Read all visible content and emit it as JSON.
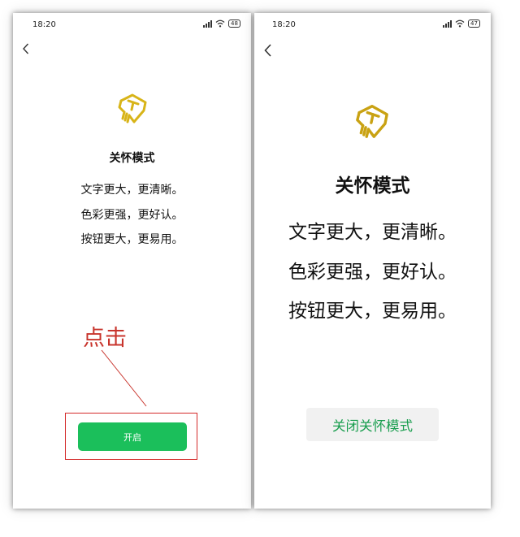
{
  "left_screen": {
    "status_time": "18:20",
    "battery": "48",
    "title": "关怀模式",
    "lines": [
      "文字更大，更清晰。",
      "色彩更强，更好认。",
      "按钮更大，更易用。"
    ],
    "button_label": "开启",
    "annotation": "点击"
  },
  "right_screen": {
    "status_time": "18:20",
    "battery": "47",
    "title": "关怀模式",
    "lines": [
      "文字更大，更清晰。",
      "色彩更强，更好认。",
      "按钮更大，更易用。"
    ],
    "button_label": "关闭关怀模式"
  },
  "colors": {
    "logo_gold": "#d8b418",
    "open_button": "#1bbf5b",
    "close_text": "#1a9e4f",
    "annotation_red": "#c8342c"
  },
  "icons": [
    "back-arrow-icon",
    "signal-icon",
    "wifi-icon",
    "battery-icon",
    "care-mode-logo-icon"
  ]
}
